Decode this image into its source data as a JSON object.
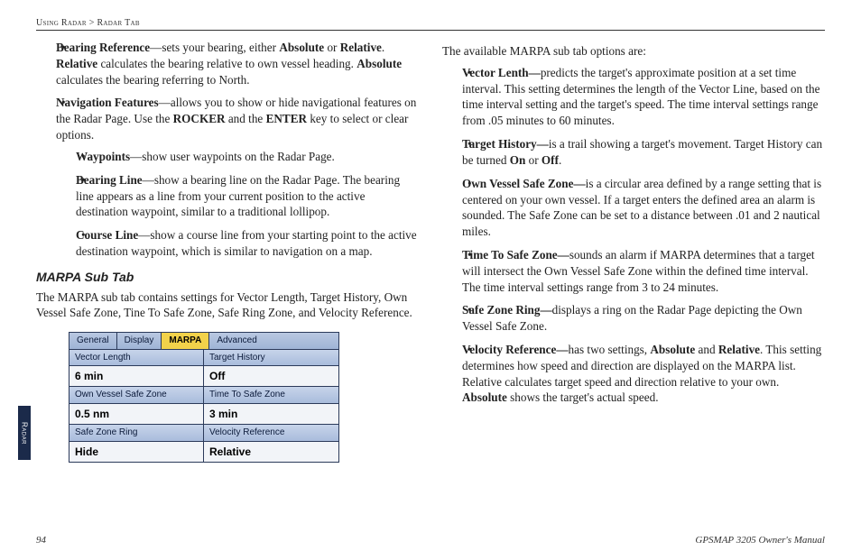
{
  "breadcrumb": {
    "section": "Using Radar",
    "sep": ">",
    "page": "Radar Tab"
  },
  "left": {
    "items": [
      {
        "term": "Bearing Reference",
        "rest": "—sets your bearing, either ",
        "b1": "Absolute",
        "mid": " or ",
        "b2": "Relative",
        "post": ". ",
        "line2a": "Relative",
        "line2b": " calculates the bearing relative to own vessel heading. ",
        "line2c": "Absolute",
        "line2d": " calculates the bearing referring to North."
      },
      {
        "term": "Navigation Features",
        "rest": "—allows you to show or hide navigational features on the Radar Page. Use the ",
        "b1": "ROCKER",
        "mid": " and the ",
        "b2": "ENTER",
        "post": " key to select or clear options.",
        "sub": [
          {
            "term": "Waypoints",
            "rest": "—show user waypoints on the Radar Page."
          },
          {
            "term": "Bearing Line",
            "rest": "—show a bearing line on the Radar Page. The bearing line appears as a line from your current position to the active destination waypoint, similar to a traditional lollipop."
          },
          {
            "term": "Course Line",
            "rest": "—show a course line from your starting point to the active destination waypoint, which is similar to navigation on a map."
          }
        ]
      }
    ],
    "h2": "MARPA Sub Tab",
    "intro": "The MARPA sub tab contains settings for Vector Length, Target History, Own Vessel Safe Zone, Tine To Safe Zone, Safe Ring Zone, and Velocity Reference.",
    "tabs": [
      "General",
      "Display",
      "MARPA",
      "Advanced"
    ],
    "active_tab": 2,
    "grid": [
      {
        "l": "Vector Length",
        "v": "6 min"
      },
      {
        "l": "Target History",
        "v": "Off"
      },
      {
        "l": "Own Vessel Safe Zone",
        "v": "0.5 nm"
      },
      {
        "l": "Time To Safe Zone",
        "v": "3 min"
      },
      {
        "l": "Safe Zone Ring",
        "v": "Hide"
      },
      {
        "l": "Velocity Reference",
        "v": "Relative"
      }
    ]
  },
  "right": {
    "lead": "The available MARPA sub tab options are:",
    "items": [
      {
        "term": "Vector Lenth—",
        "rest": "predicts the target's approximate position at a set time interval. This setting determines the length of the Vector Line, based on the time interval setting and the target's speed. The time interval settings range from .05 minutes to 60 minutes."
      },
      {
        "term": "Target History—",
        "rest": "is a trail showing a target's movement. Target History can be turned ",
        "b1": "On",
        "mid": " or ",
        "b2": "Off",
        "post": "."
      },
      {
        "term": "Own Vessel Safe Zone—",
        "rest": "is a circular area defined by a range setting that is centered on your own vessel. If a target enters the defined area an alarm is sounded. The Safe Zone can be set to a distance between .01 and 2 nautical miles."
      },
      {
        "term": "Time To Safe Zone—",
        "rest": "sounds an alarm if MARPA determines that a target will intersect the Own Vessel Safe Zone within the defined time interval. The time interval settings range from 3 to 24 minutes."
      },
      {
        "term": "Safe Zone Ring—",
        "rest": "displays a ring on the Radar Page depicting the Own Vessel Safe Zone."
      },
      {
        "term": "Velocity Reference—",
        "rest": "has two settings, ",
        "b1": "Absolute",
        "mid": " and ",
        "b2": "Relative",
        "post": ". This setting determines how speed and direction are displayed on the MARPA list. Relative calculates target speed and direction relative to your own. ",
        "tail_b": "Absolute",
        "tail": " shows the target's actual speed."
      }
    ]
  },
  "sidetab": "Radar",
  "footer": {
    "pageno": "94",
    "manual": "GPSMAP 3205 Owner's Manual"
  }
}
